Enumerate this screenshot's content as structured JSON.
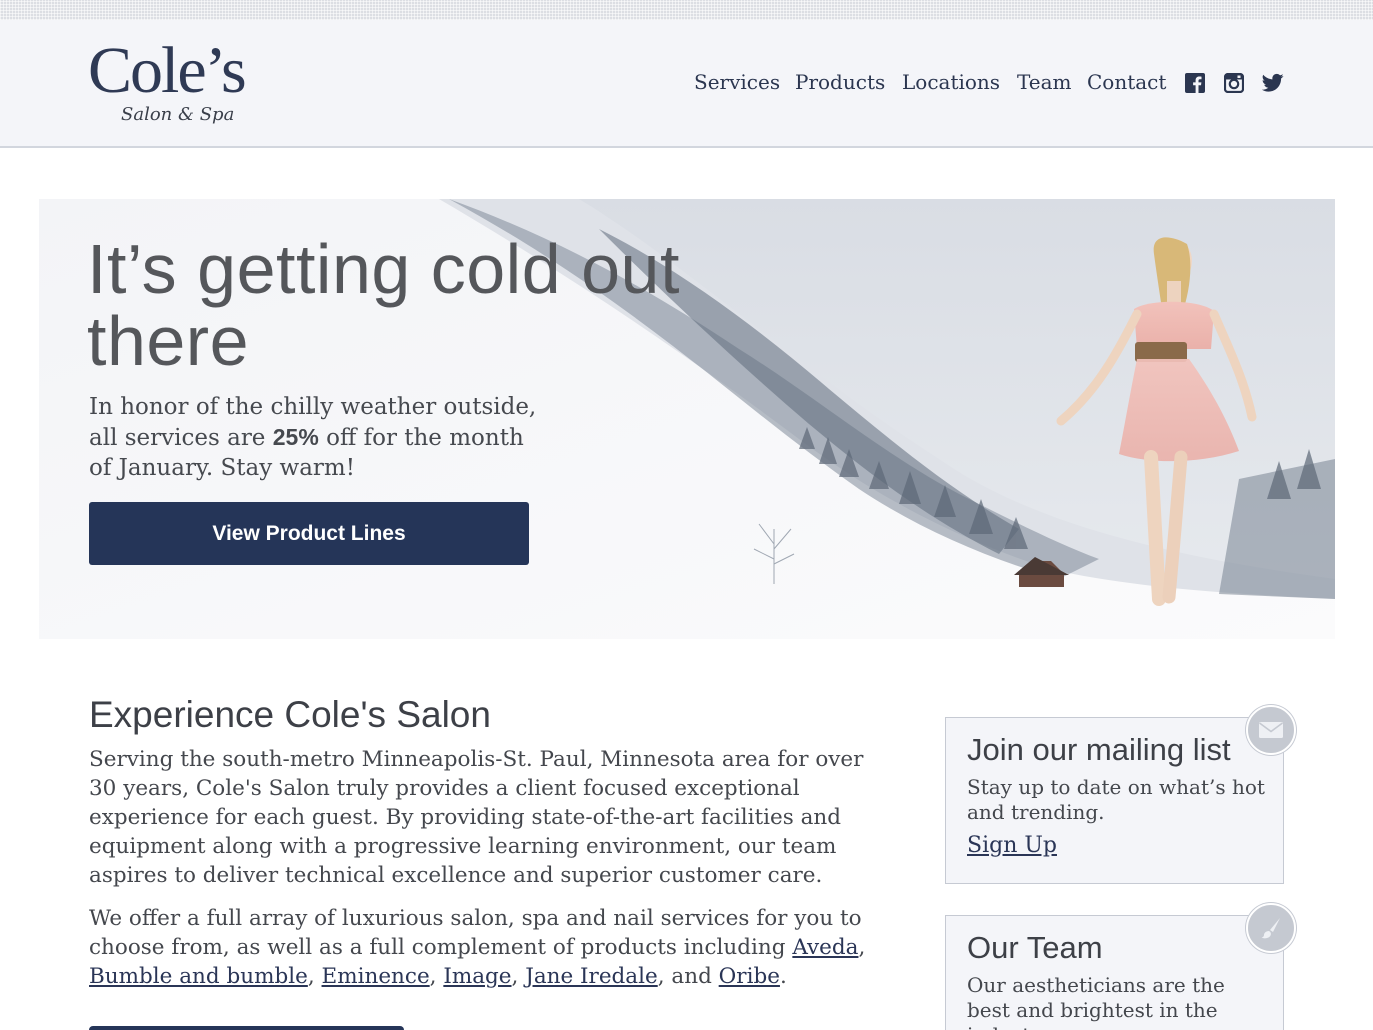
{
  "brand": {
    "name": "Cole’s",
    "tagline": "Salon & Spa"
  },
  "nav": {
    "items": [
      {
        "label": "Services"
      },
      {
        "label": "Products"
      },
      {
        "label": "Locations"
      },
      {
        "label": "Team"
      },
      {
        "label": "Contact"
      }
    ],
    "social": [
      {
        "icon": "facebook-icon"
      },
      {
        "icon": "instagram-icon"
      },
      {
        "icon": "twitter-icon"
      }
    ]
  },
  "hero": {
    "title": "It’s getting cold out there",
    "text_before": "In honor of the chilly weather outside, all services are ",
    "text_bold": "25%",
    "text_after": " off for the month of January. Stay warm!",
    "button_label": "View Product Lines"
  },
  "main": {
    "title": "Experience Cole's Salon",
    "paragraph1": "Serving the south-metro Minneapolis-St. Paul, Minnesota area for over 30 years, Cole's Salon truly provides a client focused exceptional experience for each guest. By providing state-of-the-art facilities and equipment along with a progressive learning environment, our team aspires to deliver technical excellence and superior customer care.",
    "paragraph2_intro": "We offer a full array of luxurious salon, spa and nail services for you to choose from, as well as a full complement of products including ",
    "brands": [
      "Aveda",
      "Bumble and bumble",
      "Eminence",
      "Image",
      "Jane Iredale",
      "Oribe"
    ],
    "separator": ", ",
    "and_text": ", and ",
    "end_text": "."
  },
  "sidebar": {
    "mailing": {
      "title": "Join our mailing list",
      "text": "Stay up to date on what’s hot and trending.",
      "link": "Sign Up",
      "icon": "envelope-icon"
    },
    "team": {
      "title": "Our Team",
      "text": "Our aestheticians are the best and brightest in the industry.",
      "icon": "brush-icon"
    }
  },
  "colors": {
    "navy": "#253558",
    "header_bg": "#f4f5f9",
    "text": "#3d4148"
  }
}
